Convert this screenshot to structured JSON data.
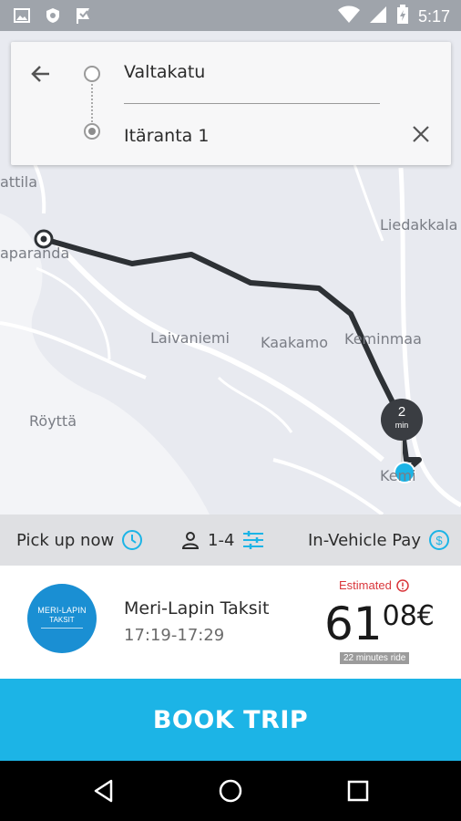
{
  "status_bar": {
    "time": "5:17",
    "left_icons": [
      "image-icon",
      "shield-icon",
      "checkmark-flag-icon"
    ],
    "right_icons": [
      "wifi-icon",
      "signal-icon",
      "battery-charging-icon"
    ]
  },
  "search": {
    "origin": "Valtakatu",
    "destination": "Itäranta 1"
  },
  "map": {
    "places": {
      "hattila": "attila",
      "haparanda": "aparanda",
      "liedakkala": "Liedakkala",
      "laivaniemi": "Laivaniemi",
      "kaakamo": "Kaakamo",
      "keminmaa": "Keminmaa",
      "roytta": "Röyttä",
      "kemi": "Kemi"
    },
    "eta_value": "2",
    "eta_unit": "min"
  },
  "options": {
    "pickup_label": "Pick up now",
    "passengers_label": "1-4",
    "payment_label": "In-Vehicle Pay"
  },
  "offer": {
    "logo_text": "MERI-LAPIN",
    "logo_sub": "TAKSIT",
    "company": "Meri-Lapin Taksit",
    "time_window": "17:19-17:29",
    "estimated_label": "Estimated",
    "price_int": "61",
    "price_cents": "08€",
    "ride_duration": "22 minutes ride"
  },
  "book_button": "BOOK TRIP",
  "colors": {
    "accent": "#1cb4e6",
    "estimate_red": "#d9353a",
    "route": "#2d3135",
    "logo_blue": "#1a8fd3"
  }
}
